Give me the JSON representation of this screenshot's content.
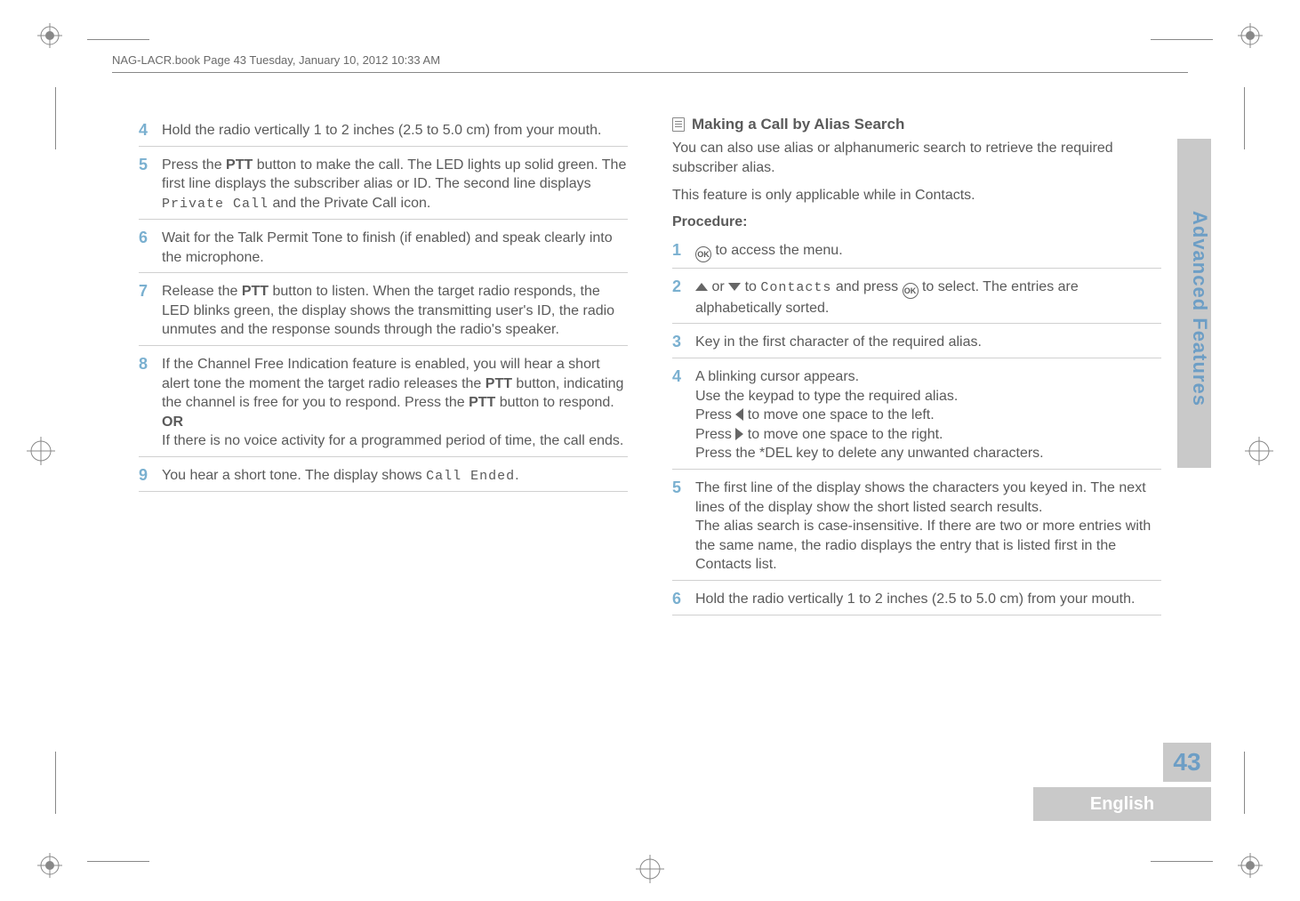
{
  "header": {
    "text": "NAG-LACR.book  Page 43  Tuesday, January 10, 2012  10:33 AM"
  },
  "left_column": {
    "steps": [
      {
        "num": "4",
        "html": "Hold the radio vertically 1 to 2 inches (2.5 to 5.0 cm) from your mouth."
      },
      {
        "num": "5",
        "html": "Press the <b>PTT</b> button to make the call. The LED lights up solid green. The first line displays the subscriber alias or ID. The second line displays <span class='mono'>Private Call</span> and the Private Call icon."
      },
      {
        "num": "6",
        "html": "Wait for the Talk Permit Tone to finish (if enabled) and speak clearly into the microphone."
      },
      {
        "num": "7",
        "html": "Release the <b>PTT</b> button to listen. When the target radio responds, the LED blinks green, the display shows the transmitting user's ID, the radio unmutes and the response sounds through the radio's speaker."
      },
      {
        "num": "8",
        "html": "If the Channel Free Indication feature is enabled, you will hear a short alert tone the moment the target radio releases the <b>PTT</b> button, indicating the channel is free for you to respond. Press the <b>PTT</b> button to respond.<br><b>OR</b><br>If there is no voice activity for a programmed period of time, the call ends."
      },
      {
        "num": "9",
        "html": "You hear a short tone. The display shows <span class='mono'>Call Ended</span>."
      }
    ]
  },
  "right_column": {
    "section_title": "Making a Call by Alias Search",
    "intro1": "You can also use alias or alphanumeric search to retrieve the required subscriber alias.",
    "intro2": "This feature is only applicable while in Contacts.",
    "procedure_label": "Procedure:",
    "steps": [
      {
        "num": "1",
        "html": "<span class='icon-ok'>OK</span> to access the menu."
      },
      {
        "num": "2",
        "html": "<span class='tri-up'></span> or <span class='tri-down'></span> to <span class='mono'>Contacts</span> and press <span class='icon-ok'>OK</span> to select. The entries are alphabetically sorted."
      },
      {
        "num": "3",
        "html": "Key in the first character of the required alias."
      },
      {
        "num": "4",
        "html": "A blinking cursor appears.<br>Use the keypad to type the required alias.<br>Press <span class='tri-left'></span> to move one space to the left.<br>Press <span class='tri-right'></span> to move one space to the right.<br>Press the *DEL key to delete any unwanted characters."
      },
      {
        "num": "5",
        "html": "The first line of the display shows the characters you keyed in. The next lines of the display show the short listed search results.<br>The alias search is case-insensitive. If there are two or more entries with the same name, the radio displays the entry that is listed first in the Contacts list."
      },
      {
        "num": "6",
        "html": "Hold the radio vertically 1 to 2 inches (2.5 to 5.0 cm) from your mouth."
      }
    ]
  },
  "side_tab": "Advanced Features",
  "page_number": "43",
  "language": "English"
}
